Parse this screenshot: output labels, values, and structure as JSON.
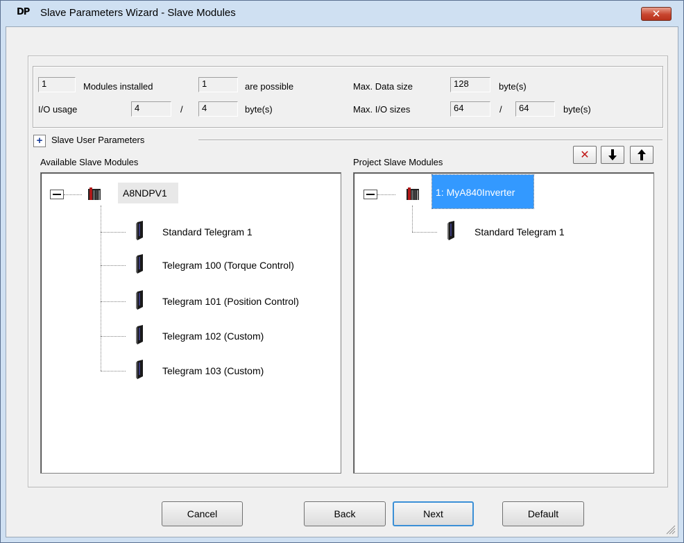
{
  "window": {
    "logo": "DP",
    "title": "Slave Parameters Wizard - Slave Modules",
    "close_glyph": "✕"
  },
  "info": {
    "modules_installed_value": "1",
    "modules_installed_label": "Modules installed",
    "possible_value": "1",
    "possible_label": "are possible",
    "io_usage_label": "I/O usage",
    "io_usage_in": "4",
    "io_usage_sep": "/",
    "io_usage_out": "4",
    "io_usage_unit": "byte(s)",
    "max_data_label": "Max. Data size",
    "max_data_value": "128",
    "max_data_unit": "byte(s)",
    "max_io_label": "Max. I/O sizes",
    "max_io_in": "64",
    "max_io_sep": "/",
    "max_io_out": "64",
    "max_io_unit": "byte(s)"
  },
  "user_params": {
    "toggle": "+",
    "label": "Slave User Parameters"
  },
  "available": {
    "heading": "Available Slave Modules",
    "root": "A8NDPV1",
    "root_icon": "rack-module-icon",
    "items": [
      "Standard Telegram 1",
      "Telegram 100 (Torque Control)",
      "Telegram 101 (Position Control)",
      "Telegram 102 (Custom)",
      "Telegram 103 (Custom)"
    ]
  },
  "project": {
    "heading": "Project Slave Modules",
    "root": "1: MyA840Inverter",
    "items": [
      "Standard Telegram 1"
    ],
    "selection_color": "#3399ff"
  },
  "tools": {
    "delete_glyph": "✕",
    "down_glyph": "🡓",
    "up_glyph": "🡑",
    "delete_color": "#c01818"
  },
  "buttons": {
    "cancel": "Cancel",
    "back": "Back",
    "next": "Next",
    "default": "Default"
  }
}
